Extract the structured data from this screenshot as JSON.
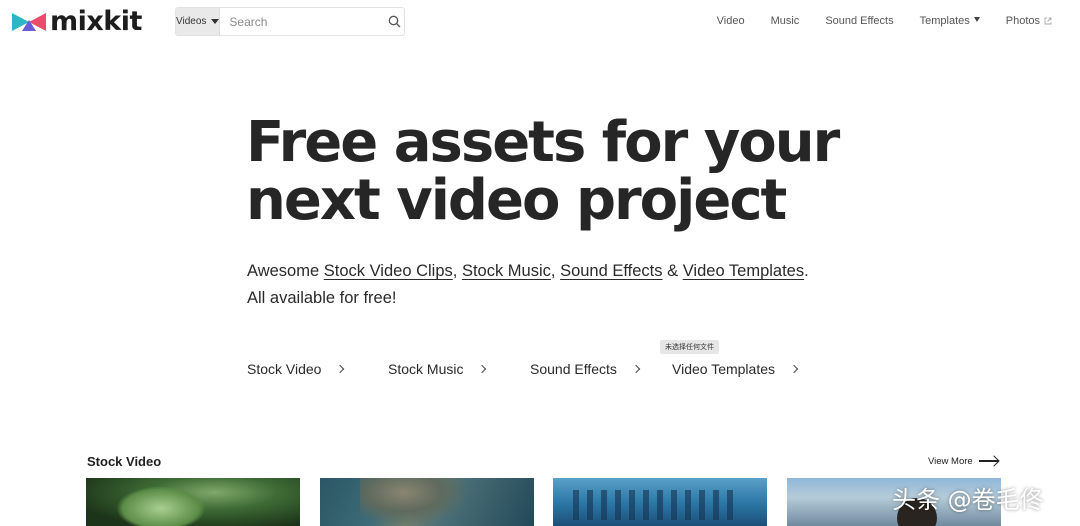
{
  "brand": {
    "name": "mixkit",
    "colors": {
      "teal": "#2bb6c4",
      "pink": "#ec4c6c",
      "purple": "#6b5bd6",
      "dark": "#1d1d1d"
    }
  },
  "search": {
    "type_label": "Videos",
    "placeholder": "Search"
  },
  "nav": {
    "items": [
      {
        "label": "Video"
      },
      {
        "label": "Music"
      },
      {
        "label": "Sound Effects"
      },
      {
        "label": "Templates"
      },
      {
        "label": "Photos"
      }
    ]
  },
  "hero": {
    "title_line1": "Free assets for your",
    "title_line2": "next video project",
    "subtitle": {
      "prefix": "Awesome",
      "link1": "Stock Video Clips",
      "sep1": ",",
      "link2": "Stock Music",
      "sep2": ",",
      "link3": "Sound Effects",
      "sep3": "&",
      "link4": "Video Templates",
      "suffix": ".",
      "line2": "All available for free!"
    }
  },
  "categories": [
    {
      "label": "Stock Video"
    },
    {
      "label": "Stock Music"
    },
    {
      "label": "Sound Effects"
    },
    {
      "label": "Video Templates"
    }
  ],
  "tooltip": "未选择任何文件",
  "stock_video": {
    "title": "Stock Video",
    "view_more": "View More"
  },
  "watermark": "头条 @卷毛佟"
}
